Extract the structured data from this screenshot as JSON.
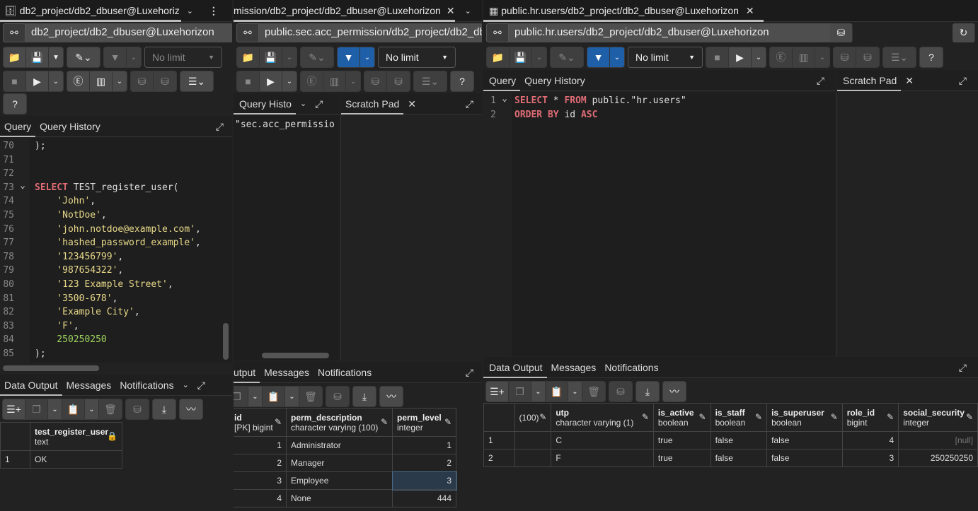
{
  "left": {
    "tab_title": "db2_project/db2_dbuser@Luxehoriz",
    "connection": "db2_project/db2_dbuser@Luxehorizon",
    "limit": "No limit",
    "editor_tabs": [
      "Query",
      "Query History"
    ],
    "code": [
      {
        "n": "70",
        "toks": [
          {
            "t": ");",
            "c": "pl"
          }
        ]
      },
      {
        "n": "71",
        "toks": []
      },
      {
        "n": "72",
        "toks": []
      },
      {
        "n": "73",
        "fold": true,
        "toks": [
          {
            "t": "SELECT",
            "c": "kw"
          },
          {
            "t": " TEST_register_user(",
            "c": "pl"
          }
        ]
      },
      {
        "n": "74",
        "toks": [
          {
            "t": "    'John'",
            "c": "str"
          },
          {
            "t": ",",
            "c": "pl"
          }
        ]
      },
      {
        "n": "75",
        "toks": [
          {
            "t": "    'NotDoe'",
            "c": "str"
          },
          {
            "t": ",",
            "c": "pl"
          }
        ]
      },
      {
        "n": "76",
        "toks": [
          {
            "t": "    'john.notdoe@example.com'",
            "c": "str"
          },
          {
            "t": ",",
            "c": "pl"
          }
        ]
      },
      {
        "n": "77",
        "toks": [
          {
            "t": "    'hashed_password_example'",
            "c": "str"
          },
          {
            "t": ",",
            "c": "pl"
          }
        ]
      },
      {
        "n": "78",
        "toks": [
          {
            "t": "    '123456799'",
            "c": "str"
          },
          {
            "t": ",",
            "c": "pl"
          }
        ]
      },
      {
        "n": "79",
        "toks": [
          {
            "t": "    '987654322'",
            "c": "str"
          },
          {
            "t": ",",
            "c": "pl"
          }
        ]
      },
      {
        "n": "80",
        "toks": [
          {
            "t": "    '123 Example Street'",
            "c": "str"
          },
          {
            "t": ",",
            "c": "pl"
          }
        ]
      },
      {
        "n": "81",
        "toks": [
          {
            "t": "    '3500-678'",
            "c": "str"
          },
          {
            "t": ",",
            "c": "pl"
          }
        ]
      },
      {
        "n": "82",
        "toks": [
          {
            "t": "    'Example City'",
            "c": "str"
          },
          {
            "t": ",",
            "c": "pl"
          }
        ]
      },
      {
        "n": "83",
        "toks": [
          {
            "t": "    'F'",
            "c": "str"
          },
          {
            "t": ",",
            "c": "pl"
          }
        ]
      },
      {
        "n": "84",
        "toks": [
          {
            "t": "    250250250",
            "c": "num"
          }
        ]
      },
      {
        "n": "85",
        "toks": [
          {
            "t": ");",
            "c": "pl"
          }
        ]
      }
    ],
    "output_tabs": [
      "Data Output",
      "Messages",
      "Notifications"
    ],
    "grid": {
      "columns": [
        {
          "name": "test_register_user",
          "type": "text"
        }
      ],
      "rows": [
        [
          "1",
          "OK"
        ]
      ]
    }
  },
  "middle": {
    "tab_title": "mission/db2_project/db2_dbuser@Luxehorizon",
    "connection": "public.sec.acc_permission/db2_project/db2_db",
    "limit": "No limit",
    "editor_tabs": [
      "Query Histo"
    ],
    "scratch_tab": "Scratch Pad",
    "code_fragment": "\"sec.acc_permissio",
    "output_tabs": [
      "utput",
      "Messages",
      "Notifications"
    ],
    "grid": {
      "columns": [
        {
          "name": "id",
          "type": "[PK] bigint"
        },
        {
          "name": "perm_description",
          "type": "character varying (100)"
        },
        {
          "name": "perm_level",
          "type": "integer"
        }
      ],
      "rows": [
        [
          "1",
          "Administrator",
          "1"
        ],
        [
          "2",
          "Manager",
          "2"
        ],
        [
          "3",
          "Employee",
          "3"
        ],
        [
          "4",
          "None",
          "444"
        ]
      ]
    }
  },
  "right": {
    "tab_title": "public.hr.users/db2_project/db2_dbuser@Luxehorizon",
    "connection": "public.hr.users/db2_project/db2_dbuser@Luxehorizon",
    "limit": "No limit",
    "editor_tabs": [
      "Query",
      "Query History"
    ],
    "scratch_tab": "Scratch Pad",
    "code": [
      {
        "n": "1",
        "fold": true,
        "toks": [
          {
            "t": "SELECT",
            "c": "kw"
          },
          {
            "t": " * ",
            "c": "pl"
          },
          {
            "t": "FROM",
            "c": "kw"
          },
          {
            "t": " public.\"hr.users\"",
            "c": "pl"
          }
        ]
      },
      {
        "n": "2",
        "toks": [
          {
            "t": "ORDER BY",
            "c": "kw"
          },
          {
            "t": " id ",
            "c": "pl"
          },
          {
            "t": "ASC",
            "c": "kw"
          }
        ]
      }
    ],
    "output_tabs": [
      "Data Output",
      "Messages",
      "Notifications"
    ],
    "grid": {
      "columns": [
        {
          "name": "",
          "type": "(100)"
        },
        {
          "name": "utp",
          "type": "character varying (1)"
        },
        {
          "name": "is_active",
          "type": "boolean"
        },
        {
          "name": "is_staff",
          "type": "boolean"
        },
        {
          "name": "is_superuser",
          "type": "boolean"
        },
        {
          "name": "role_id",
          "type": "bigint"
        },
        {
          "name": "social_security",
          "type": "integer"
        }
      ],
      "rows": [
        [
          "1",
          "",
          "C",
          "true",
          "false",
          "false",
          "4",
          "[null]"
        ],
        [
          "2",
          "",
          "F",
          "true",
          "false",
          "false",
          "3",
          "250250250"
        ]
      ]
    }
  }
}
